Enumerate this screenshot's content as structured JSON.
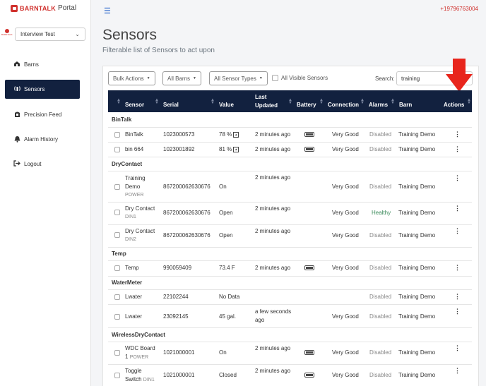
{
  "brand": {
    "name_bold": "BARNTALK",
    "name_light": "Portal",
    "farm_logo_text": "BARNTALK"
  },
  "farm_selector": {
    "value": "Interview Test"
  },
  "nav": [
    {
      "label": "Barns",
      "icon": "barn-icon"
    },
    {
      "label": "Sensors",
      "icon": "sensor-icon",
      "active": true
    },
    {
      "label": "Precision Feed",
      "icon": "feed-icon"
    },
    {
      "label": "Alarm History",
      "icon": "bell-icon"
    },
    {
      "label": "Logout",
      "icon": "logout-icon"
    }
  ],
  "topbar": {
    "phone": "+19796763004"
  },
  "page": {
    "title": "Sensors",
    "subtitle": "Filterable list of Sensors to act upon"
  },
  "filters": {
    "bulk_actions": "Bulk Actions",
    "barns": "All Barns",
    "sensor_types": "All Sensor Types",
    "visible_label": "All Visible Sensors",
    "search_label": "Search:",
    "search_value": "training"
  },
  "columns": {
    "sensor": "Sensor",
    "serial": "Serial",
    "value": "Value",
    "last_updated_1": "Last",
    "last_updated_2": "Updated",
    "battery": "Battery",
    "connection": "Connection",
    "alarms": "Alarms",
    "barn": "Barn",
    "actions": "Actions"
  },
  "groups": {
    "bintalk": "BinTalk",
    "drycontact": "DryContact",
    "temp": "Temp",
    "watermeter": "WaterMeter",
    "wirelessdry": "WirelessDryContact"
  },
  "rows": [
    {
      "sensor": "BinTalk",
      "serial": "1023000573",
      "value": "78 %",
      "updated": "2 minutes ago",
      "connection": "Very Good",
      "alarms": "Disabled",
      "barn": "Training Demo"
    },
    {
      "sensor": "bin 664",
      "serial": "1023001892",
      "value": "81 %",
      "updated": "2 minutes ago",
      "connection": "Very Good",
      "alarms": "Disabled",
      "barn": "Training Demo"
    },
    {
      "sensor_1": "Training",
      "sensor_2": "Demo",
      "sub": "POWER",
      "serial": "867200062630676",
      "value": "On",
      "updated": "2 minutes ago",
      "connection": "Very Good",
      "alarms": "Disabled",
      "barn": "Training Demo"
    },
    {
      "sensor": "Dry Contact",
      "sub": "DIN1",
      "serial": "867200062630676",
      "value": "Open",
      "updated": "2 minutes ago",
      "connection": "Very Good",
      "alarms": "Healthy",
      "barn": "Training Demo"
    },
    {
      "sensor": "Dry Contact",
      "sub": "DIN2",
      "serial": "867200062630676",
      "value": "Open",
      "updated": "2 minutes ago",
      "connection": "Very Good",
      "alarms": "Disabled",
      "barn": "Training Demo"
    },
    {
      "sensor": "Temp",
      "serial": "990059409",
      "value": "73.4 F",
      "updated": "2 minutes ago",
      "connection": "Very Good",
      "alarms": "Disabled",
      "barn": "Training Demo"
    },
    {
      "sensor": "Lwater",
      "serial": "22102244",
      "value": "No Data",
      "alarms": "Disabled",
      "barn": "Training Demo"
    },
    {
      "sensor": "Lwater",
      "serial": "23092145",
      "value": "45 gal.",
      "updated_1": "a few seconds",
      "updated_2": "ago",
      "connection": "Very Good",
      "alarms": "Disabled",
      "barn": "Training Demo"
    },
    {
      "sensor_1": "WDC Board",
      "sensor_2": "1",
      "sub": "POWER",
      "serial": "1021000001",
      "value": "On",
      "updated": "2 minutes ago",
      "connection": "Very Good",
      "alarms": "Disabled",
      "barn": "Training Demo"
    },
    {
      "sensor_1": "Toggle",
      "sensor_2": "Switch",
      "sub": "DIN1",
      "serial": "1021000001",
      "value": "Closed",
      "updated": "2 minutes ago",
      "connection": "Very Good",
      "alarms": "Disabled",
      "barn": "Training Demo"
    }
  ],
  "actions_glyph": "⋮",
  "colors": {
    "navy": "#12213f",
    "brand_red": "#d0312d",
    "arrow_red": "#e8251c",
    "link_blue": "#2563c9"
  }
}
